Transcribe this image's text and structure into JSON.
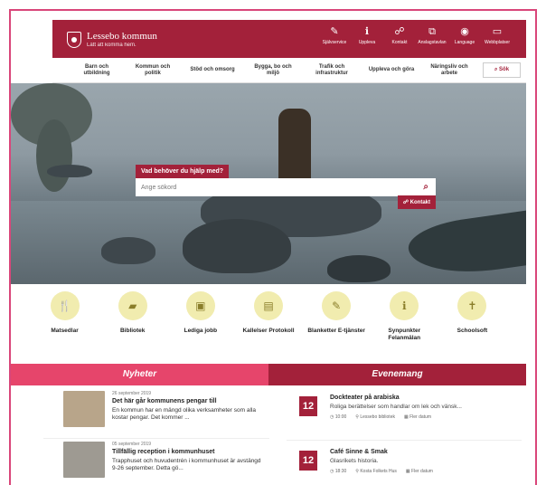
{
  "site": {
    "name": "Lessebo kommun",
    "tagline": "Lätt att komma hem."
  },
  "topnav": [
    {
      "label": "Självservice",
      "icon": "edit-icon"
    },
    {
      "label": "Uppleva",
      "icon": "info-icon"
    },
    {
      "label": "Kontakt",
      "icon": "chat-icon"
    },
    {
      "label": "Anslagstavlan",
      "icon": "bulletin-icon"
    },
    {
      "label": "Language",
      "icon": "globe-icon"
    },
    {
      "label": "Webbplatser",
      "icon": "monitor-icon"
    }
  ],
  "mainnav": [
    "Barn och utbildning",
    "Kommun och politik",
    "Stöd och omsorg",
    "Bygga, bo och miljö",
    "Trafik och infrastruktur",
    "Uppleva och göra",
    "Näringsliv och arbete"
  ],
  "search_label": "Sök",
  "hero": {
    "question": "Vad behöver du hjälp med?",
    "placeholder": "Ange sökord",
    "kontakt": "Kontakt"
  },
  "quicklinks": [
    {
      "label": "Matsedlar",
      "icon": "fork-knife-icon"
    },
    {
      "label": "Bibliotek",
      "icon": "book-icon"
    },
    {
      "label": "Lediga jobb",
      "icon": "briefcase-icon"
    },
    {
      "label": "Kallelser Protokoll",
      "icon": "document-icon"
    },
    {
      "label": "Blanketter E-tjänster",
      "icon": "edit-icon"
    },
    {
      "label": "Synpunkter Felanmälan",
      "icon": "info-icon"
    },
    {
      "label": "Schoolsoft",
      "icon": "person-icon"
    }
  ],
  "news": {
    "header": "Nyheter",
    "items": [
      {
        "date": "26 september 2019",
        "title": "Det här går kommunens pengar till",
        "body": "En kommun har en mängd olika verksamheter som alla kostar pengar. Det kommer ..."
      },
      {
        "date": "05 september 2019",
        "title": "Tillfällig reception i kommunhuset",
        "body": "Trapphuset och huvudentrén i kommunhuset är avstängd 9-26 september. Detta gö..."
      }
    ]
  },
  "events": {
    "header": "Evenemang",
    "items": [
      {
        "day": "12",
        "title": "Dockteater på arabiska",
        "desc": "Roliga berättelser som handlar om lek och vänsk...",
        "time": "10:00",
        "place": "Lessebo bibliotek",
        "more": "Fler datum"
      },
      {
        "day": "12",
        "title": "Café Sinne & Smak",
        "desc": "Glasrikets historia.",
        "time": "18:30",
        "place": "Kosta Folkets Hus",
        "more": "Fler datum"
      }
    ]
  },
  "colors": {
    "brand": "#a3213a",
    "news": "#e6456b",
    "quick_circle": "#f1ecaf"
  }
}
